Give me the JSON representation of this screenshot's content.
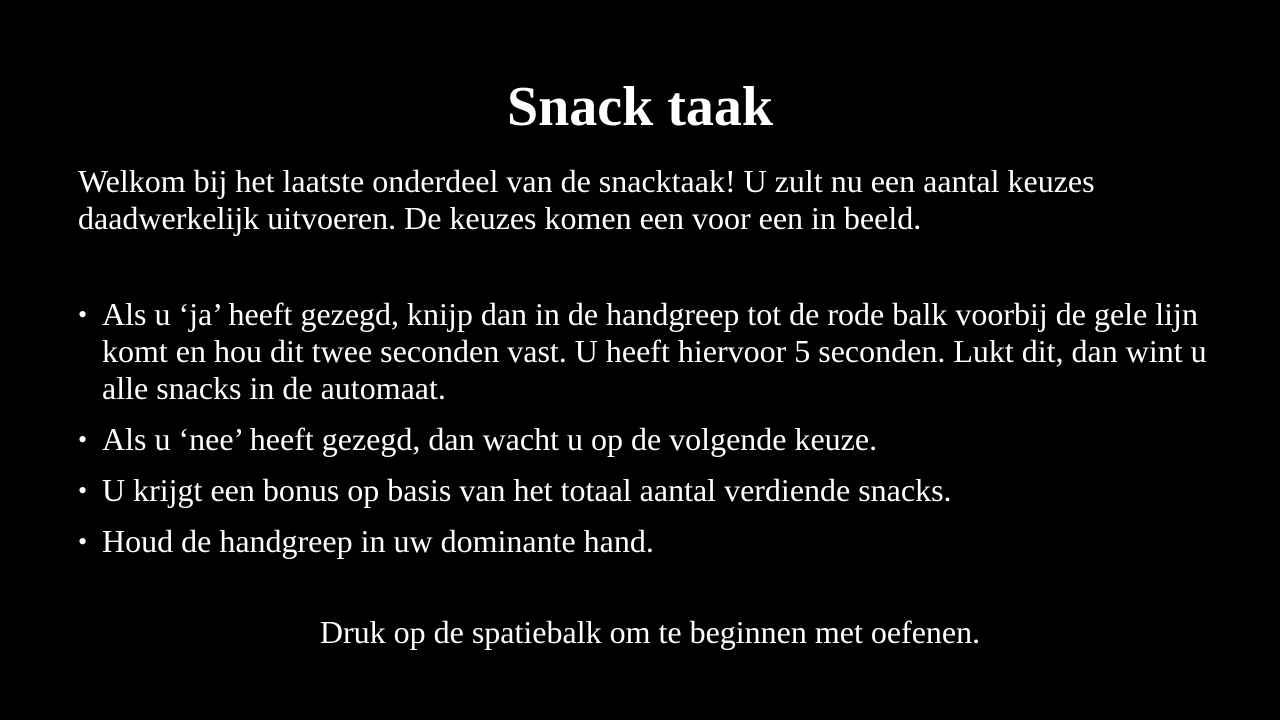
{
  "slide": {
    "title": "Snack taak",
    "intro": "Welkom bij het laatste onderdeel van de snacktaak! U zult nu een aantal keuzes daadwerkelijk uitvoeren. De keuzes komen een voor een in beeld.",
    "bullet_glyph": "•",
    "bullets": [
      "Als u ‘ja’ heeft gezegd, knijp dan in de handgreep tot de rode balk voorbij de gele lijn komt en hou dit twee seconden vast. U heeft hiervoor 5 seconden. Lukt dit, dan wint u alle snacks in de automaat.",
      "Als u ‘nee’ heeft gezegd, dan wacht u op de volgende keuze.",
      "U krijgt een bonus op basis van het totaal aantal verdiende snacks.",
      "Houd de handgreep in uw dominante hand."
    ],
    "footer": "Druk op de spatiebalk om te beginnen met oefenen."
  },
  "colors": {
    "background": "#000000",
    "text": "#ffffff"
  }
}
